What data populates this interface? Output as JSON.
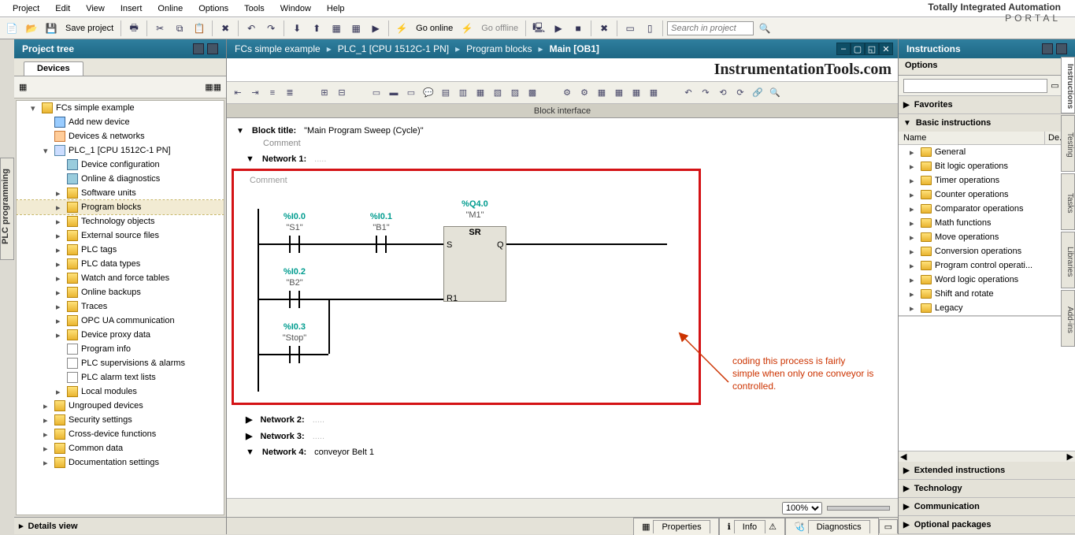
{
  "menu": [
    "Project",
    "Edit",
    "View",
    "Insert",
    "Online",
    "Options",
    "Tools",
    "Window",
    "Help"
  ],
  "brand": {
    "l1": "Totally Integrated Automation",
    "l2": "PORTAL"
  },
  "toolbar": {
    "save": "Save project",
    "go_online": "Go online",
    "go_offline": "Go offline",
    "search_ph": "Search in project"
  },
  "left": {
    "title": "Project tree",
    "devices_tab": "Devices",
    "vtab": "PLC programming",
    "details": "Details view",
    "tree": [
      {
        "t": "FCs  simple example",
        "lvl": 1,
        "ico": "i-folder",
        "arr": "▾"
      },
      {
        "t": "Add new device",
        "lvl": 2,
        "ico": "i-device"
      },
      {
        "t": "Devices & networks",
        "lvl": 2,
        "ico": "i-net"
      },
      {
        "t": "PLC_1 [CPU 1512C-1 PN]",
        "lvl": 2,
        "ico": "i-prog",
        "arr": "▾"
      },
      {
        "t": "Device configuration",
        "lvl": 3,
        "ico": "i-blue"
      },
      {
        "t": "Online & diagnostics",
        "lvl": 3,
        "ico": "i-blue"
      },
      {
        "t": "Software units",
        "lvl": 3,
        "ico": "i-folder",
        "arr": "▸"
      },
      {
        "t": "Program blocks",
        "lvl": 3,
        "ico": "i-folder",
        "hl": true,
        "arr": "▸"
      },
      {
        "t": "Technology objects",
        "lvl": 3,
        "ico": "i-folder",
        "arr": "▸"
      },
      {
        "t": "External source files",
        "lvl": 3,
        "ico": "i-folder",
        "arr": "▸"
      },
      {
        "t": "PLC tags",
        "lvl": 3,
        "ico": "i-folder",
        "arr": "▸"
      },
      {
        "t": "PLC data types",
        "lvl": 3,
        "ico": "i-folder",
        "arr": "▸"
      },
      {
        "t": "Watch and force tables",
        "lvl": 3,
        "ico": "i-folder",
        "arr": "▸"
      },
      {
        "t": "Online backups",
        "lvl": 3,
        "ico": "i-folder",
        "arr": "▸"
      },
      {
        "t": "Traces",
        "lvl": 3,
        "ico": "i-folder",
        "arr": "▸"
      },
      {
        "t": "OPC UA communication",
        "lvl": 3,
        "ico": "i-folder",
        "arr": "▸"
      },
      {
        "t": "Device proxy data",
        "lvl": 3,
        "ico": "i-folder",
        "arr": "▸"
      },
      {
        "t": "Program info",
        "lvl": 3,
        "ico": "i-doc"
      },
      {
        "t": "PLC supervisions & alarms",
        "lvl": 3,
        "ico": "i-doc"
      },
      {
        "t": "PLC alarm text lists",
        "lvl": 3,
        "ico": "i-doc"
      },
      {
        "t": "Local modules",
        "lvl": 3,
        "ico": "i-folder",
        "arr": "▸"
      },
      {
        "t": "Ungrouped devices",
        "lvl": 2,
        "ico": "i-folder",
        "arr": "▸"
      },
      {
        "t": "Security settings",
        "lvl": 2,
        "ico": "i-folder",
        "arr": "▸"
      },
      {
        "t": "Cross-device functions",
        "lvl": 2,
        "ico": "i-folder",
        "arr": "▸"
      },
      {
        "t": "Common data",
        "lvl": 2,
        "ico": "i-folder",
        "arr": "▸"
      },
      {
        "t": "Documentation settings",
        "lvl": 2,
        "ico": "i-folder",
        "arr": "▸"
      }
    ]
  },
  "center": {
    "crumbs": [
      "FCs  simple example",
      "PLC_1 [CPU 1512C-1 PN]",
      "Program blocks",
      "Main [OB1]"
    ],
    "watermark": "InstrumentationTools.com",
    "block_iface": "Block interface",
    "block_title_lbl": "Block title:",
    "block_title_val": "\"Main Program Sweep (Cycle)\"",
    "comment": "Comment",
    "net1": "Network 1:",
    "net2": "Network 2:",
    "net3": "Network 3:",
    "net4": "Network 4:",
    "net4_title": "conveyor Belt 1",
    "ladder": {
      "i0": {
        "addr": "%I0.0",
        "sym": "\"S1\""
      },
      "i1": {
        "addr": "%I0.1",
        "sym": "\"B1\""
      },
      "i2": {
        "addr": "%I0.2",
        "sym": "\"B2\""
      },
      "i3": {
        "addr": "%I0.3",
        "sym": "\"Stop\""
      },
      "q0": {
        "addr": "%Q4.0",
        "sym": "\"M1\"",
        "type": "SR",
        "s": "S",
        "r": "R1",
        "q": "Q"
      }
    },
    "annotation": "coding this process is fairly simple when only one conveyor is controlled.",
    "zoom": "100%",
    "tabs": {
      "p": "Properties",
      "i": "Info",
      "d": "Diagnostics"
    }
  },
  "right": {
    "title": "Instructions",
    "options": "Options",
    "favorites": "Favorites",
    "basic": "Basic instructions",
    "col_name": "Name",
    "col_de": "De...",
    "items": [
      "General",
      "Bit logic operations",
      "Timer operations",
      "Counter operations",
      "Comparator operations",
      "Math functions",
      "Move operations",
      "Conversion operations",
      "Program control operati...",
      "Word logic operations",
      "Shift and rotate",
      "Legacy"
    ],
    "ext": "Extended instructions",
    "tech": "Technology",
    "comm": "Communication",
    "opt": "Optional packages",
    "vtabs": [
      "Instructions",
      "Testing",
      "Tasks",
      "Libraries",
      "Add-ins"
    ]
  }
}
